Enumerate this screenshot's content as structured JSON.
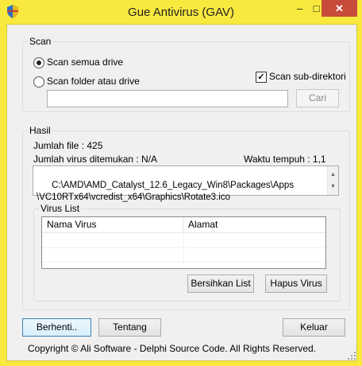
{
  "window": {
    "title": "Gue Antivirus (GAV)",
    "min_glyph": "–",
    "max_glyph": "□",
    "close_glyph": "✕"
  },
  "scan": {
    "legend": "Scan",
    "radio_all_label": "Scan semua drive",
    "radio_folder_label": "Scan folder atau drive",
    "radio_all_checked": true,
    "subdir_label": "Scan sub-direktori",
    "subdir_checked": true,
    "path_value": "",
    "browse_label": "Cari"
  },
  "result": {
    "legend": "Hasil",
    "file_count": "Jumlah file : 425",
    "virus_found": "Jumlah virus ditemukan : N/A",
    "elapsed": "Waktu tempuh : 1,1",
    "current_path": "C:\\AMD\\AMD_Catalyst_12.6_Legacy_Win8\\Packages\\Apps\n\\VC10RTx64\\vcredist_x64\\Graphics\\Rotate3.ico"
  },
  "virus_list": {
    "legend": "Virus List",
    "columns": [
      "Nama Virus",
      "Alamat"
    ],
    "rows": [],
    "clean_label": "Bersihkan List",
    "delete_label": "Hapus Virus"
  },
  "footer": {
    "stop_label": "Berhenti..",
    "about_label": "Tentang",
    "exit_label": "Keluar",
    "copyright": "Copyright © Ali Software - Delphi Source Code. All Rights Reserved."
  },
  "colors": {
    "frame": "#f9e93f",
    "close": "#c74a3a",
    "face": "#f0f0f0"
  }
}
